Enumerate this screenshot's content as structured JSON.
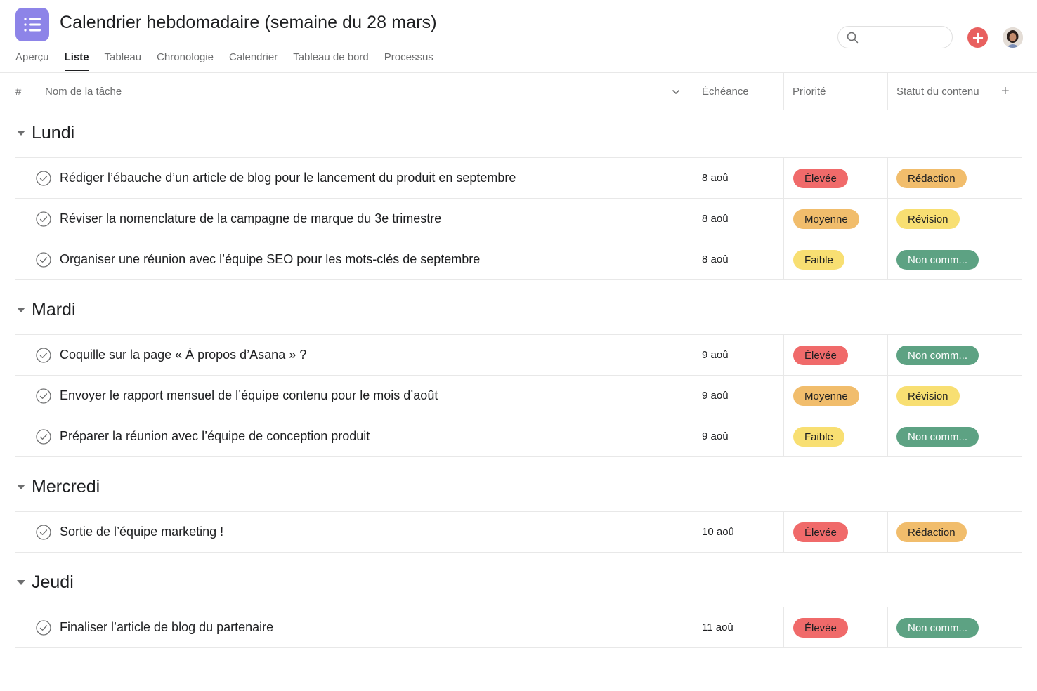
{
  "header": {
    "title": "Calendrier hebdomadaire (semaine du 28 mars)",
    "app_icon": "list-icon",
    "tabs": [
      {
        "label": "Aperçu",
        "active": false
      },
      {
        "label": "Liste",
        "active": true
      },
      {
        "label": "Tableau",
        "active": false
      },
      {
        "label": "Chronologie",
        "active": false
      },
      {
        "label": "Calendrier",
        "active": false
      },
      {
        "label": "Tableau de bord",
        "active": false
      },
      {
        "label": "Processus",
        "active": false
      }
    ],
    "search": {
      "placeholder": "",
      "value": ""
    },
    "add_icon": "plus-icon",
    "avatar": "user-avatar"
  },
  "columns": {
    "number": "#",
    "task_name": "Nom de la tâche",
    "due_date": "Échéance",
    "priority": "Priorité",
    "content_status": "Statut du contenu",
    "add_column": "+"
  },
  "colors": {
    "accent": "#8d84e8",
    "add_button": "#e8605f",
    "priority": {
      "Élevée": {
        "bg": "#f06a6a",
        "fg": "#1e1f21"
      },
      "Moyenne": {
        "bg": "#f1bd6c",
        "fg": "#1e1f21"
      },
      "Faible": {
        "bg": "#f8df72",
        "fg": "#1e1f21"
      }
    },
    "status": {
      "Rédaction": {
        "bg": "#f1bd6c",
        "fg": "#1e1f21"
      },
      "Révision": {
        "bg": "#f8df72",
        "fg": "#1e1f21"
      },
      "Non comm...": {
        "bg": "#5da283",
        "fg": "#ffffff"
      }
    }
  },
  "sections": [
    {
      "title": "Lundi",
      "tasks": [
        {
          "name": "Rédiger l’ébauche d’un article de blog pour le lancement du produit en septembre",
          "due": "8 aoû",
          "priority": "Élevée",
          "status": "Rédaction"
        },
        {
          "name": "Réviser la nomenclature de la campagne de marque du 3e trimestre",
          "due": "8 aoû",
          "priority": "Moyenne",
          "status": "Révision"
        },
        {
          "name": "Organiser une réunion avec l’équipe SEO pour les mots-clés de septembre",
          "due": "8 aoû",
          "priority": "Faible",
          "status": "Non comm..."
        }
      ]
    },
    {
      "title": "Mardi",
      "tasks": [
        {
          "name": "Coquille sur la page « À propos d’Asana » ?",
          "due": "9 aoû",
          "priority": "Élevée",
          "status": "Non comm..."
        },
        {
          "name": "Envoyer le rapport mensuel de l’équipe contenu pour le mois d’août",
          "due": "9 aoû",
          "priority": "Moyenne",
          "status": "Révision"
        },
        {
          "name": "Préparer la réunion avec l’équipe de conception produit",
          "due": "9 aoû",
          "priority": "Faible",
          "status": "Non comm..."
        }
      ]
    },
    {
      "title": "Mercredi",
      "tasks": [
        {
          "name": "Sortie de l’équipe marketing !",
          "due": "10 aoû",
          "priority": "Élevée",
          "status": "Rédaction"
        }
      ]
    },
    {
      "title": "Jeudi",
      "tasks": [
        {
          "name": "Finaliser l’article de blog du partenaire",
          "due": "11 aoû",
          "priority": "Élevée",
          "status": "Non comm..."
        }
      ]
    }
  ]
}
